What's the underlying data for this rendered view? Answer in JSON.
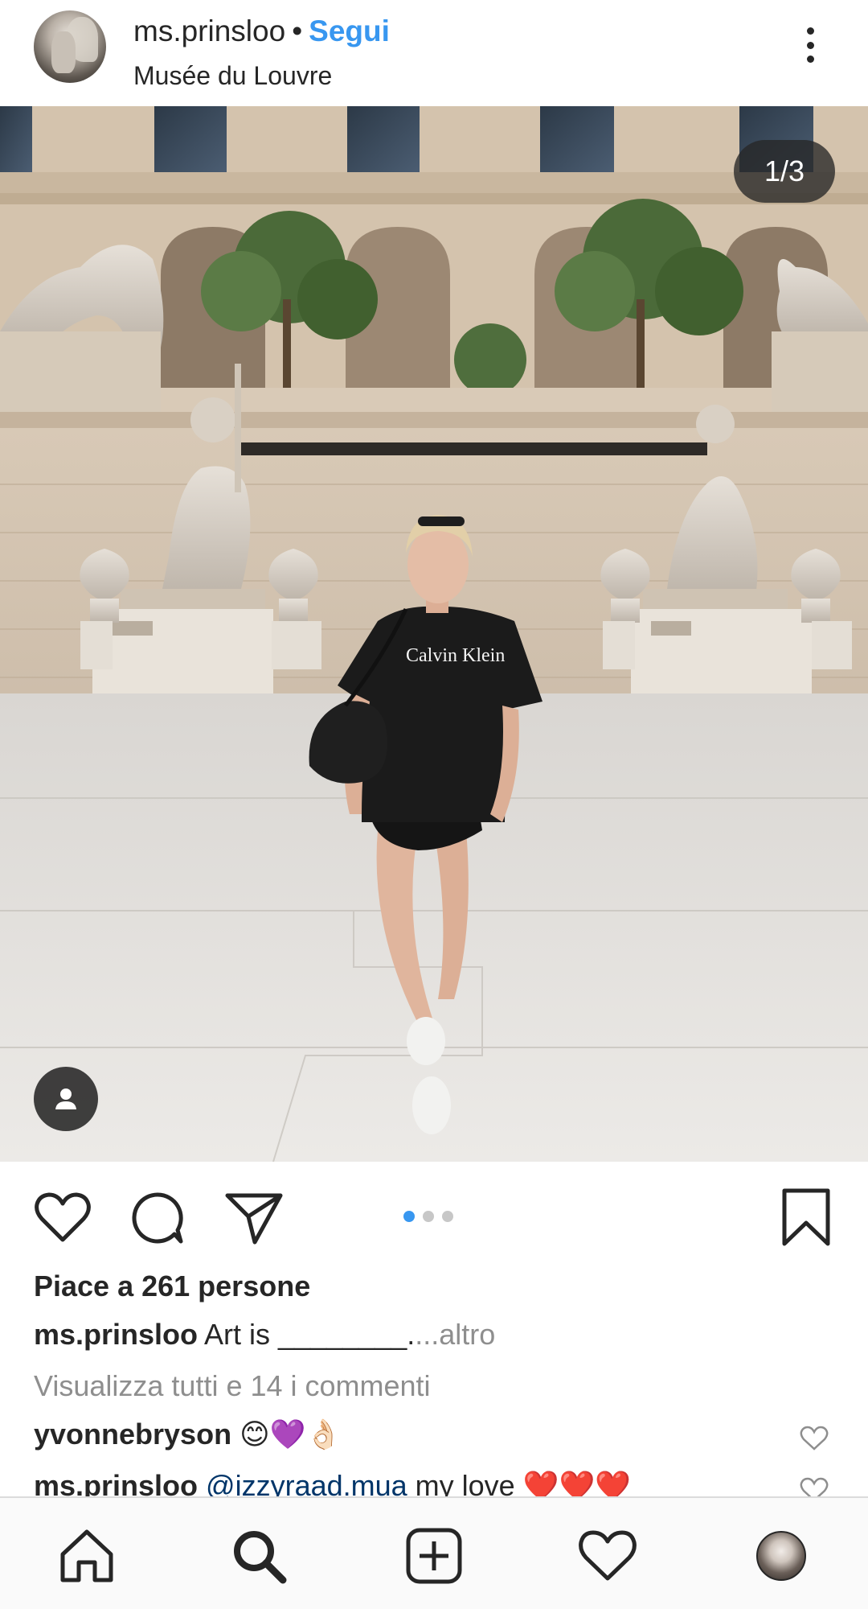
{
  "header": {
    "username": "ms.prinsloo",
    "separator": "•",
    "follow_label": "Segui",
    "location": "Musée du Louvre"
  },
  "photo": {
    "counter": "1/3",
    "slide_index": 1,
    "slide_count": 3,
    "print_text": "Calvin Klein"
  },
  "post": {
    "likes": "Piace a 261 persone",
    "caption_user": "ms.prinsloo",
    "caption_text": " Art is ________.",
    "caption_more": "...altro",
    "view_all": "Visualizza tutti e 14 i commenti",
    "comments": [
      {
        "user": "yvonnebryson",
        "text": " 😊💜👌🏻"
      },
      {
        "user": "ms.prinsloo",
        "mention": " @izzyraad.mua",
        "text": " my love ❤️❤️❤️"
      }
    ]
  },
  "colors": {
    "accent": "#3897f0",
    "text": "#262626",
    "muted": "#8e8e8e",
    "mention": "#003569"
  },
  "icons": {
    "nav": [
      "home-icon",
      "search-icon",
      "add-post-icon",
      "activity-heart-icon",
      "profile-avatar"
    ],
    "actions": [
      "like-heart-icon",
      "comment-bubble-icon",
      "share-paper-plane-icon",
      "bookmark-icon"
    ]
  }
}
